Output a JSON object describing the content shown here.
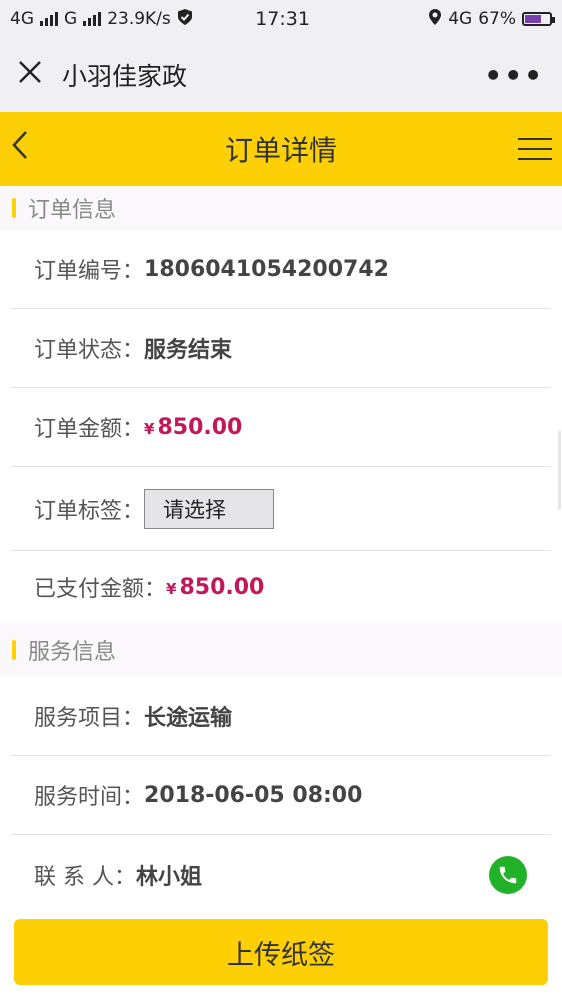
{
  "status_bar": {
    "network1": "4G",
    "network2": "G",
    "speed": "23.9K/s",
    "time": "17:31",
    "network3": "4G",
    "battery": "67%",
    "battery_level": 0.67
  },
  "wechat_bar": {
    "title": "小羽佳家政",
    "more": "•••"
  },
  "nav": {
    "title": "订单详情",
    "accent_color": "#fdd005"
  },
  "order_section": {
    "heading": "订单信息",
    "rows": [
      {
        "label": "订单编号：",
        "value": "1806041054200742"
      },
      {
        "label": "订单状态：",
        "value": "服务结束"
      },
      {
        "label": "订单金额：",
        "currency": "¥",
        "value": "850.00"
      },
      {
        "label": "订单标签：",
        "select": "请选择"
      },
      {
        "label": "已支付金额：",
        "currency": "¥",
        "value": "850.00"
      }
    ]
  },
  "service_section": {
    "heading": "服务信息",
    "rows": [
      {
        "label": "服务项目：",
        "value": "长途运输"
      },
      {
        "label": "服务时间：",
        "value": "2018-06-05 08:00"
      },
      {
        "label": "联 系 人：",
        "value": "林小姐"
      }
    ]
  },
  "footer": {
    "upload_label": "上传纸签"
  },
  "colors": {
    "price": "#c2185b",
    "phone": "#22b22a"
  }
}
